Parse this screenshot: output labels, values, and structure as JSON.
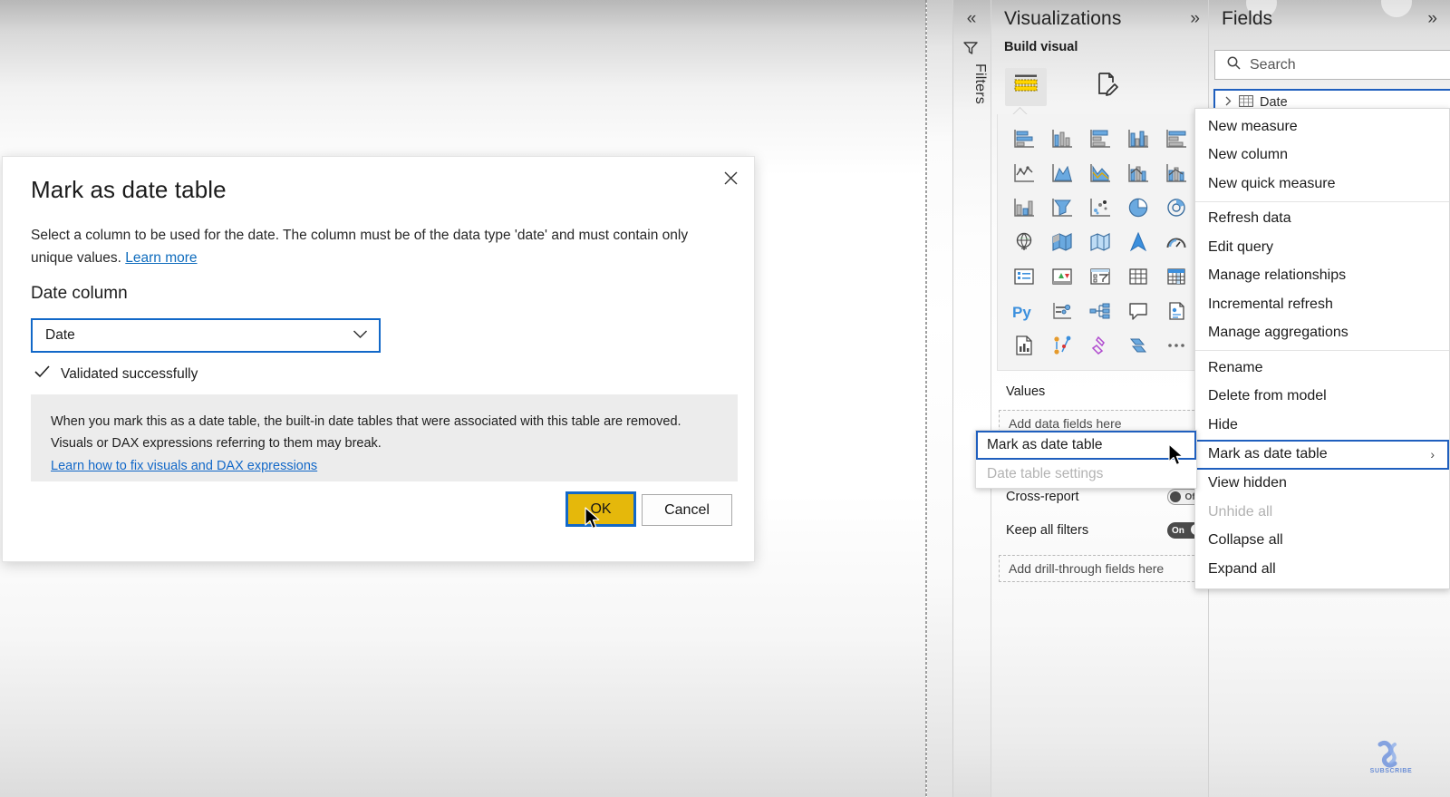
{
  "dialog": {
    "title": "Mark as date table",
    "description_part1": "Select a column to be used for the date. The column must be of the data type 'date' and must contain only unique values. ",
    "learn_more": "Learn more",
    "section_label": "Date column",
    "select_value": "Date",
    "validation_text": "Validated successfully",
    "note_line1": "When you mark this as a date table, the built-in date tables that were associated with this table are removed.",
    "note_line2": "Visuals or DAX expressions referring to them may break.",
    "note_link": "Learn how to fix visuals and DAX expressions",
    "ok_label": "OK",
    "cancel_label": "Cancel",
    "accent_blue": "#1268c8",
    "ok_yellow": "#e5b80b"
  },
  "filters_rail": {
    "label": "Filters",
    "collapse_glyph": "«"
  },
  "visualizations": {
    "title": "Visualizations",
    "expand_glyph": "»",
    "build_visual_label": "Build visual",
    "values_label": "Values",
    "values_placeholder": "Add data fields here",
    "drillthrough_placeholder": "Add drill-through fields here",
    "options": [
      {
        "label": "Cross-report",
        "state": "Off"
      },
      {
        "label": "Keep all filters",
        "state": "On"
      }
    ],
    "gallery_icons": [
      "stacked-bar-chart-icon",
      "stacked-column-chart-icon",
      "clustered-bar-chart-icon",
      "clustered-column-chart-icon",
      "hundred-percent-stacked-bar-chart-icon",
      "line-chart-icon",
      "area-chart-icon",
      "stacked-area-chart-icon",
      "line-stacked-column-chart-icon",
      "line-clustered-column-chart-icon",
      "ribbon-chart-icon",
      "waterfall-chart-icon",
      "scatter-chart-icon",
      "pie-chart-icon",
      "donut-chart-icon",
      "globe-map-icon",
      "filled-map-icon",
      "shape-map-icon",
      "arcgis-map-icon",
      "gauge-icon",
      "card-icon",
      "multi-row-card-icon",
      "kpi-icon",
      "slicer-icon",
      "table-icon",
      "matrix-icon",
      "py-visual-icon",
      "r-visual-icon",
      "key-influencers-icon",
      "decomposition-tree-icon",
      "qna-icon",
      "smart-narrative-icon",
      "paginated-report-icon",
      "power-apps-icon",
      "power-automate-icon",
      "more-options-icon"
    ]
  },
  "fields": {
    "title": "Fields",
    "expand_glyph": "»",
    "search_placeholder": "Search",
    "selected_table": "Date"
  },
  "context_menu": {
    "items": [
      {
        "label": "New measure",
        "state": "normal",
        "submenu": false
      },
      {
        "label": "New column",
        "state": "normal",
        "submenu": false
      },
      {
        "label": "New quick measure",
        "state": "normal",
        "submenu": false
      },
      {
        "label": "Refresh data",
        "state": "normal",
        "submenu": false
      },
      {
        "label": "Edit query",
        "state": "normal",
        "submenu": false
      },
      {
        "label": "Manage relationships",
        "state": "normal",
        "submenu": false
      },
      {
        "label": "Incremental refresh",
        "state": "normal",
        "submenu": false
      },
      {
        "label": "Manage aggregations",
        "state": "normal",
        "submenu": false
      },
      {
        "label": "Rename",
        "state": "normal",
        "submenu": false
      },
      {
        "label": "Delete from model",
        "state": "normal",
        "submenu": false
      },
      {
        "label": "Hide",
        "state": "normal",
        "submenu": false
      },
      {
        "label": "Mark as date table",
        "state": "selected",
        "submenu": true
      },
      {
        "label": "View hidden",
        "state": "normal",
        "submenu": false
      },
      {
        "label": "Unhide all",
        "state": "disabled",
        "submenu": false
      },
      {
        "label": "Collapse all",
        "state": "normal",
        "submenu": false
      },
      {
        "label": "Expand all",
        "state": "normal",
        "submenu": false
      }
    ],
    "submenu_glyph": "›"
  },
  "submenu_popup": {
    "items": [
      {
        "label": "Mark as date table",
        "state": "selected"
      },
      {
        "label": "Date table settings",
        "state": "disabled"
      }
    ]
  },
  "watermark": {
    "text": "SUBSCRIBE"
  }
}
